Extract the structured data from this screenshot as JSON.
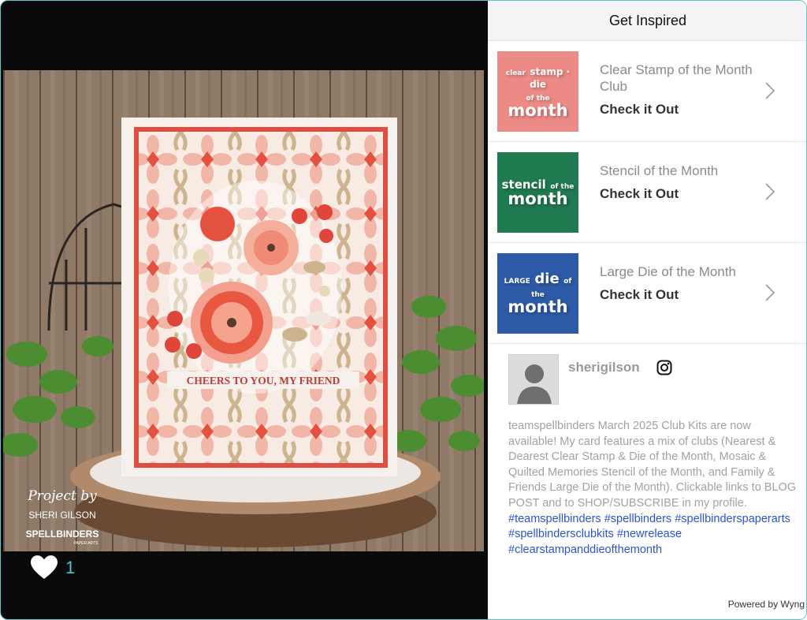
{
  "header": {
    "title": "Get Inspired"
  },
  "promos": [
    {
      "thumb_small": "clear",
      "thumb_mid": "stamp · die",
      "thumb_small2": "of the",
      "thumb_big": "month",
      "title": "Clear Stamp of the Month Club",
      "cta": "Check it Out",
      "color": "#ec8a86"
    },
    {
      "thumb_mid": "stencil",
      "thumb_small2": "of the",
      "thumb_big": "month",
      "title": "Stencil of the Month",
      "cta": "Check it Out",
      "color": "#1f7a4f"
    },
    {
      "thumb_small": "LARGE",
      "thumb_mid": "die",
      "thumb_small2": "of the",
      "thumb_big": "month",
      "title": "Large Die of the Month",
      "cta": "Check it Out",
      "color": "#2d5aa6"
    }
  ],
  "post": {
    "username": "sherigilson",
    "caption": "teamspellbinders March 2025 Club Kits are now available! My card features a mix of clubs (Nearest & Dearest Clear Stamp & Die of the Month, Mosaic & Quilted Memories Stencil of the Month, and Family & Friends Large Die of the Month). Clickable links to BLOG POST and to SHOP/SUBSCRIBE in my profile.",
    "hashtags": [
      "#teamspellbinders",
      "#spellbinders",
      "#spellbinderspaperarts",
      "#spellbindersclubkits",
      "#newrelease",
      "#clearstampanddieofthemonth"
    ]
  },
  "photo": {
    "sentiment": "CHEERS TO YOU, MY FRIEND",
    "credit_script": "Project by",
    "credit_name": "SHERI GILSON",
    "credit_brand": "SPELLBINDERS",
    "credit_sub": "PAPER ARTS"
  },
  "likes": {
    "count": "1"
  },
  "footer": {
    "powered": "Powered by Wyng"
  },
  "colors": {
    "accent": "#4fc3c6",
    "link": "#2a53d8",
    "card_red": "#e0554a"
  }
}
